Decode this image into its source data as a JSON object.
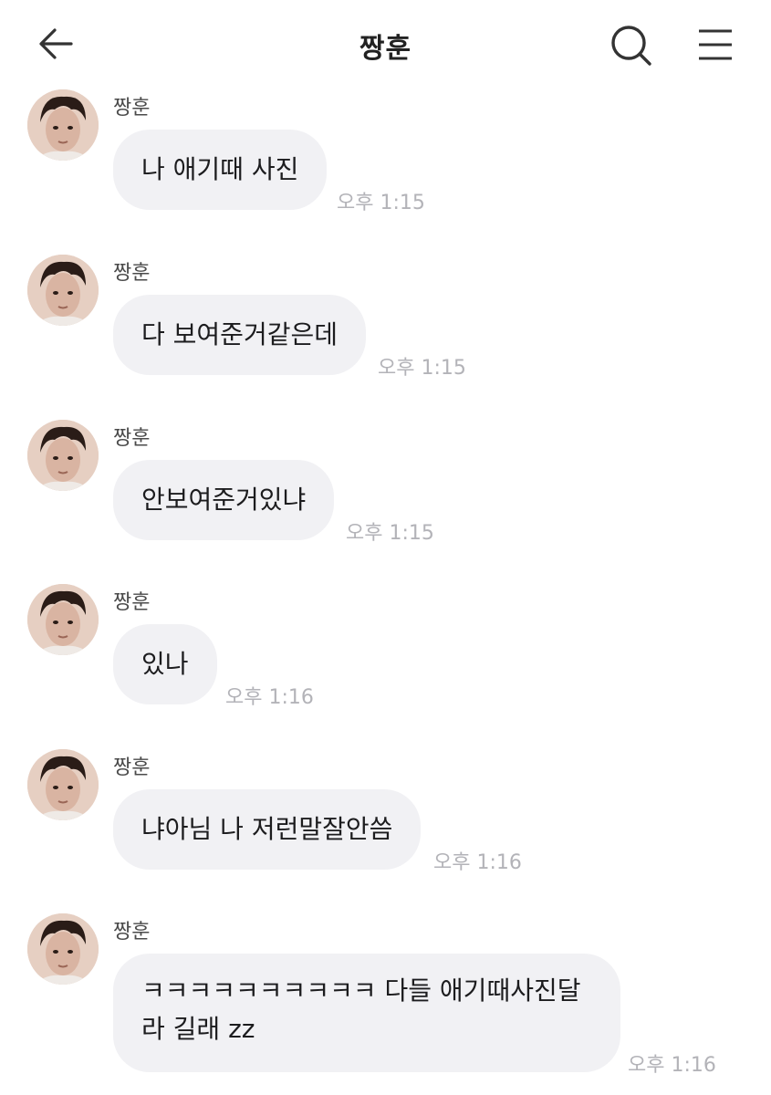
{
  "header": {
    "back_icon": "arrow-left-icon",
    "title": "짱훈",
    "search_icon": "search-icon",
    "menu_icon": "hamburger-menu-icon"
  },
  "messages": [
    {
      "sender": "짱훈",
      "text": "나 애기때 사진",
      "time": "오후 1:15"
    },
    {
      "sender": "짱훈",
      "text": "다 보여준거같은데",
      "time": "오후 1:15"
    },
    {
      "sender": "짱훈",
      "text": "안보여준거있냐",
      "time": "오후 1:15"
    },
    {
      "sender": "짱훈",
      "text": "있나",
      "time": "오후 1:16"
    },
    {
      "sender": "짱훈",
      "text": "냐아님 나 저런말잘안씀",
      "time": "오후 1:16"
    },
    {
      "sender": "짱훈",
      "text": "ㅋㅋㅋㅋㅋㅋㅋㅋㅋㅋ 다들 애기때사진달라 길래 zz",
      "time": "오후 1:16"
    }
  ],
  "colors": {
    "bubble_bg": "#f1f1f4",
    "time_text": "#b3b3b8",
    "sender_text": "#4a4a4a"
  }
}
